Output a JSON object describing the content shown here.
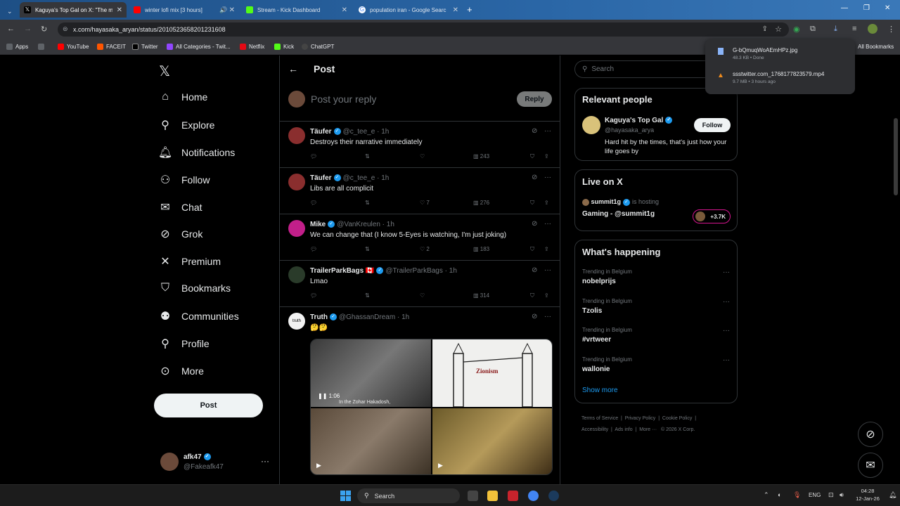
{
  "browser": {
    "tabs": [
      {
        "title": "Kaguya's Top Gal on X: \"The m",
        "favicon_color": "#000000"
      },
      {
        "title": "winter lofi mix [3 hours]",
        "favicon_color": "#ff0000"
      },
      {
        "title": "Stream - Kick Dashboard",
        "favicon_color": "#53fc18"
      },
      {
        "title": "population iran - Google Searc",
        "favicon_color": "#4285f4"
      }
    ],
    "url": "x.com/hayasaka_aryan/status/2010523658201231608",
    "bookmarks": [
      "Apps",
      "YouTube",
      "FACEIT",
      "Twitter",
      "All Categories - Twit...",
      "Netflix",
      "Kick",
      "ChatGPT"
    ],
    "all_bookmarks": "All Bookmarks",
    "downloads": [
      {
        "name": "G-bQmuqWoAEmHPz.jpg",
        "meta": "48.3 KB • Done"
      },
      {
        "name": "ssstwitter.com_1768177823579.mp4",
        "meta": "9.7 MB • 3 hours ago"
      }
    ]
  },
  "nav": {
    "items": [
      {
        "label": "Home",
        "icon": "home-icon"
      },
      {
        "label": "Explore",
        "icon": "search-icon"
      },
      {
        "label": "Notifications",
        "icon": "bell-icon"
      },
      {
        "label": "Follow",
        "icon": "add-person-icon"
      },
      {
        "label": "Chat",
        "icon": "mail-icon"
      },
      {
        "label": "Grok",
        "icon": "grok-icon"
      },
      {
        "label": "Premium",
        "icon": "x-icon"
      },
      {
        "label": "Bookmarks",
        "icon": "bookmark-icon"
      },
      {
        "label": "Communities",
        "icon": "communities-icon"
      },
      {
        "label": "Profile",
        "icon": "person-icon"
      },
      {
        "label": "More",
        "icon": "more-circle-icon"
      }
    ],
    "post_button": "Post",
    "account": {
      "name": "afk47",
      "handle": "@Fakeafk47"
    }
  },
  "main": {
    "header": "Post",
    "reply_placeholder": "Post your reply",
    "reply_button": "Reply",
    "replies": [
      {
        "name": "Täufer",
        "handle": "@c_tee_e",
        "time": "1h",
        "text": "Destroys their narrative immediately",
        "likes": "",
        "views": "243",
        "avatar_color": "#8a2e2e"
      },
      {
        "name": "Täufer",
        "handle": "@c_tee_e",
        "time": "1h",
        "text": "Libs are all complicit",
        "likes": "7",
        "views": "276",
        "avatar_color": "#8a2e2e"
      },
      {
        "name": "Mike",
        "handle": "@VanKreulen",
        "time": "1h",
        "text": "We can change that (I know 5-Eyes is watching, I'm just joking)",
        "likes": "2",
        "views": "183",
        "avatar_color": "#c21f8a"
      },
      {
        "name": "TrailerParkBags 🇨🇦",
        "handle": "@TrailerParkBags",
        "time": "1h",
        "text": "Lmao",
        "likes": "",
        "views": "314",
        "avatar_color": "#2a3b2a"
      }
    ],
    "media_post": {
      "name": "Truth",
      "handle": "@GhassanDream",
      "time": "1h",
      "text": "🤔🤔",
      "video_time": "1:06",
      "caption": "In the Zohar Hakadosh,",
      "zionism_label": "Zionism"
    }
  },
  "right": {
    "search_placeholder": "Search",
    "relevant": {
      "title": "Relevant people",
      "name": "Kaguya's Top Gal",
      "handle": "@hayasaka_aryan",
      "bio": "Hard hit by the times, that's just how your life goes by",
      "follow": "Follow"
    },
    "live": {
      "title": "Live on X",
      "host": "summit1g",
      "hosting": "is hosting",
      "stream": "Gaming - @summit1g",
      "count": "+3.7K"
    },
    "happening": {
      "title": "What's happening",
      "trends": [
        {
          "label": "Trending in Belgium",
          "name": "nobelprijs"
        },
        {
          "label": "Trending in Belgium",
          "name": "Tzolis"
        },
        {
          "label": "Trending in Belgium",
          "name": "#vrtweer"
        },
        {
          "label": "Trending in Belgium",
          "name": "wallonie"
        }
      ],
      "show_more": "Show more"
    },
    "footer": [
      "Terms of Service",
      "Privacy Policy",
      "Cookie Policy",
      "Accessibility",
      "Ads info",
      "More ···",
      "© 2026 X Corp."
    ]
  },
  "taskbar": {
    "search": "Search",
    "lang": "ENG",
    "time": "04:28",
    "date": "12-Jan-26"
  }
}
